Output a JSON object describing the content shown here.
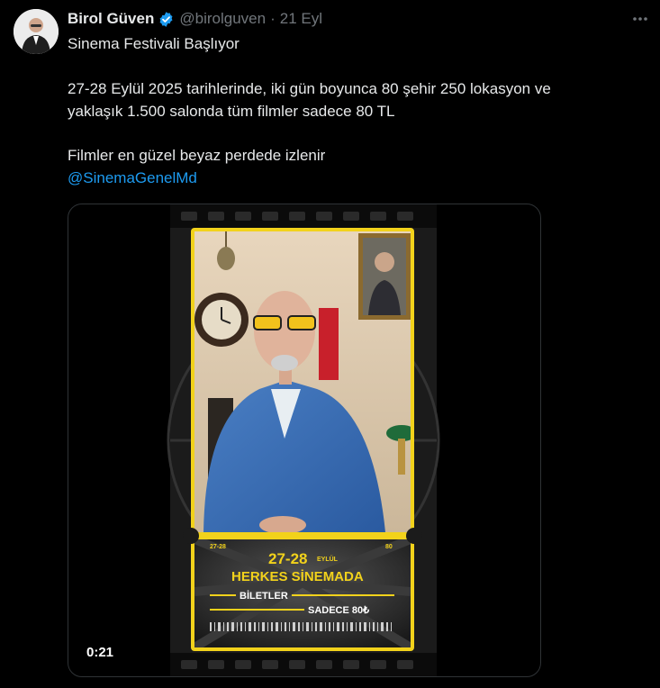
{
  "author": {
    "name": "Birol Güven",
    "handle": "@birolguven",
    "separator": "·",
    "date": "21 Eyl"
  },
  "tweet": {
    "line1": "Sinema Festivali Başlıyor",
    "line2": "27-28 Eylül 2025 tarihlerinde, iki gün boyunca 80 şehir 250 lokasyon ve",
    "line3": "yaklaşık 1.500 salonda tüm filmler sadece 80 TL",
    "line4": "Filmler en güzel beyaz perdede izlenir",
    "mention": "@SinemaGenelMd"
  },
  "media": {
    "duration": "0:21",
    "poster": {
      "date_left": "27-28",
      "date_right": "80",
      "headline_days": "27-28",
      "headline_month": "EYLÜL",
      "headline_text": "HERKES SİNEMADA",
      "tickets_label": "BİLETLER",
      "price_label": "SADECE 80₺"
    }
  },
  "icons": {
    "verified": "verified-badge-icon",
    "more": "more-horizontal-icon"
  },
  "colors": {
    "background": "#000000",
    "text": "#e7e9ea",
    "secondary": "#71767b",
    "link": "#1d9bf0",
    "poster_yellow": "#f2d21b"
  }
}
